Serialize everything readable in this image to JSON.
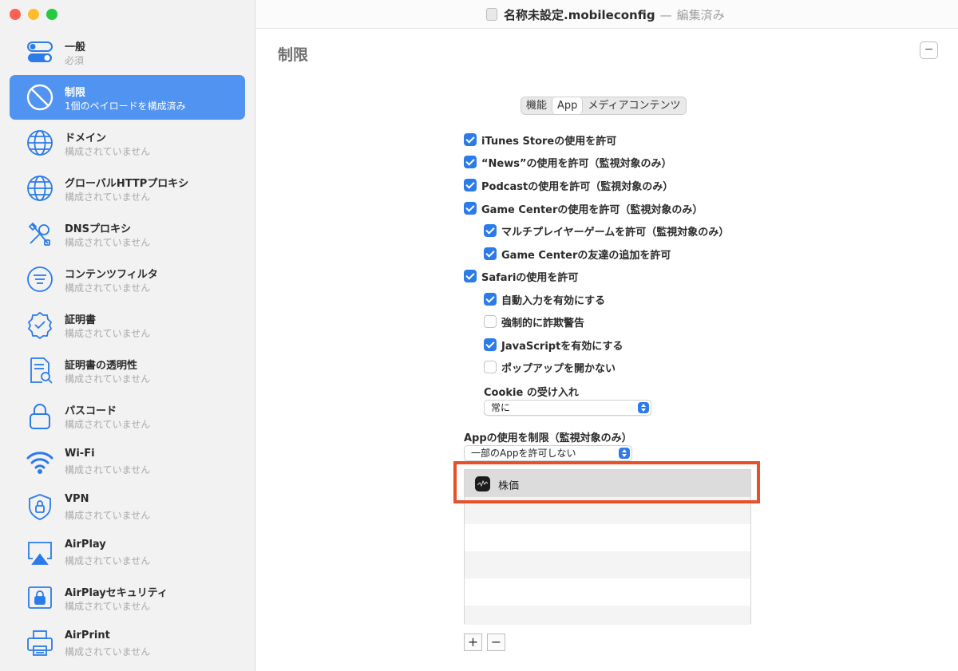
{
  "window": {
    "filename": "名称未設定.mobileconfig",
    "separator": "—",
    "state": "編集済み",
    "traffic_colors": [
      "#fe5f57",
      "#febc2e",
      "#28c840"
    ]
  },
  "sidebar": {
    "items": [
      {
        "title": "一般",
        "subtitle": "必須",
        "icon": "toggle-icon"
      },
      {
        "title": "制限",
        "subtitle": "1個のペイロードを構成済み",
        "icon": "restriction-icon",
        "selected": true
      },
      {
        "title": "ドメイン",
        "subtitle": "構成されていません",
        "icon": "globe-icon"
      },
      {
        "title": "グローバルHTTPプロキシ",
        "subtitle": "構成されていません",
        "icon": "globe-icon"
      },
      {
        "title": "DNSプロキシ",
        "subtitle": "構成されていません",
        "icon": "tools-icon"
      },
      {
        "title": "コンテンツフィルタ",
        "subtitle": "構成されていません",
        "icon": "filter-icon"
      },
      {
        "title": "証明書",
        "subtitle": "構成されていません",
        "icon": "certificate-icon"
      },
      {
        "title": "証明書の透明性",
        "subtitle": "構成されていません",
        "icon": "document-search-icon"
      },
      {
        "title": "パスコード",
        "subtitle": "構成されていません",
        "icon": "lock-icon"
      },
      {
        "title": "Wi-Fi",
        "subtitle": "構成されていません",
        "icon": "wifi-icon"
      },
      {
        "title": "VPN",
        "subtitle": "構成されていません",
        "icon": "shield-lock-icon"
      },
      {
        "title": "AirPlay",
        "subtitle": "構成されていません",
        "icon": "airplay-icon"
      },
      {
        "title": "AirPlayセキュリティ",
        "subtitle": "構成されていません",
        "icon": "airplay-lock-icon"
      },
      {
        "title": "AirPrint",
        "subtitle": "構成されていません",
        "icon": "printer-icon"
      }
    ]
  },
  "main": {
    "section_title": "制限",
    "collapse_label": "−",
    "tabs": [
      {
        "label": "機能",
        "active": false
      },
      {
        "label": "App",
        "active": true
      },
      {
        "label": "メディアコンテンツ",
        "active": false
      }
    ],
    "checkboxes": {
      "itunes": {
        "label": "iTunes Storeの使用を許可",
        "checked": true
      },
      "news": {
        "label": "“News”の使用を許可（監視対象のみ）",
        "checked": true
      },
      "podcasts": {
        "label": "Podcastの使用を許可（監視対象のみ）",
        "checked": true
      },
      "game_center": {
        "label": "Game Centerの使用を許可（監視対象のみ）",
        "checked": true
      },
      "multiplayer": {
        "label": "マルチプレイヤーゲームを許可（監視対象のみ）",
        "checked": true
      },
      "add_friends": {
        "label": "Game Centerの友達の追加を許可",
        "checked": true
      },
      "safari": {
        "label": "Safariの使用を許可",
        "checked": true
      },
      "autofill": {
        "label": "自動入力を有効にする",
        "checked": true
      },
      "fraud_warning": {
        "label": "強制的に詐欺警告",
        "checked": false
      },
      "javascript": {
        "label": "JavaScriptを有効にする",
        "checked": true
      },
      "block_popups": {
        "label": "ポップアップを開かない",
        "checked": false
      }
    },
    "cookie": {
      "label": "Cookie の受け入れ",
      "value": "常に"
    },
    "app_restrict": {
      "label": "Appの使用を制限（監視対象のみ）",
      "value": "一部のAppを許可しない"
    },
    "app_list": [
      {
        "name": "株価",
        "icon": "stocks-icon"
      }
    ],
    "add_label": "+",
    "remove_label": "−",
    "highlight_color": "#e8502a",
    "accent_color": "#2b7be8"
  }
}
